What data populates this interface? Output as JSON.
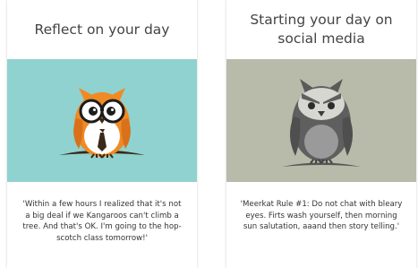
{
  "cards": [
    {
      "title": "Reflect on your day",
      "quote": "'Within a few hours I realized that it's not a big deal if we Kangaroos can't climb a tree. And that's OK. I'm going to the hop-scotch class tomorrow!'",
      "image_bg": "#8fd2cf",
      "icon": "smart-owl-icon"
    },
    {
      "title": "Starting your day on social media",
      "quote": "'Meerkat Rule #1: Do not chat with bleary eyes. Firts wash yourself, then morning sun salutation, aaand then story telling.'",
      "image_bg": "#b8bbaa",
      "icon": "grumpy-owl-icon"
    }
  ]
}
